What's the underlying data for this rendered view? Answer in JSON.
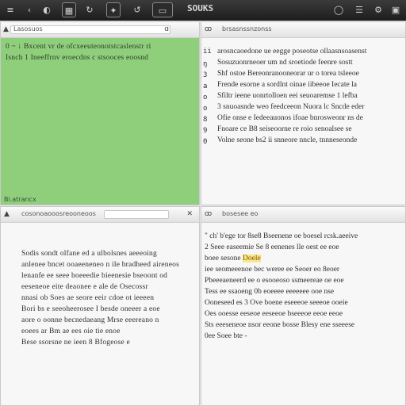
{
  "toolbar": {
    "title": "SOUKS",
    "icons": [
      "menu-icon",
      "back-icon",
      "circle-icon",
      "grid-icon",
      "refresh-icon",
      "sync-icon",
      "layout-icon",
      "clock-icon",
      "list-icon",
      "settings-icon",
      "panel-icon"
    ]
  },
  "panes": {
    "tl": {
      "header": "Lasosuos",
      "lines": [
        "0 ~ ↓ Bxcent vr de ofcxeeuteonotstcaslenstr ri",
        "Isnch  1  Ineeffrnv eroecdns c stsooces  eoosnd"
      ],
      "footer": "Bi.atrancx"
    },
    "tr": {
      "header": "brsasnssnzonss",
      "gutter": [
        "ii",
        "ŋ",
        "3",
        "a",
        "o",
        "o",
        "8",
        "9",
        "0"
      ],
      "lines": [
        "arosncaoedone ue eegge poseotse ollaasnsoasenst",
        "Sosuzuonrneoer um  nd  sroetiode  feenre  sostt",
        "Shf ostoe Bereonranooneorar  ur  o torea  tsleeoe",
        "Frende esorne a sordlnt oinae iibeeoe  Iecate  la",
        "Sfiltr  ieene  uonrtolloen  eei seuoaremse   1 lefba",
        "3 snuoasnde weo  feedceeon  Nuora lc  Sncde eder",
        "Ofie onse  e  Iedeeauonos  ifoae bnrosweonr  ns de",
        "Fnoare  ce B8 seiseoorne  re  roio  senoalsee  se",
        "Volne seone bs2 ii  snneore nncle,  tnnneseonde"
      ]
    },
    "bl": {
      "header": "cosonoaooosreooneoos",
      "lines": [
        "Sodis  sondt olfane ed  a  ulbolsnes aeeeoing",
        "anlenee bncet  ooaeeneneo n ile  bradheed aireneos",
        "lenanfe ee seee  boeeedie   bieenesie  bseoont  od",
        "eeseneoe  eite  deaonee  e  ale de  Osecossr",
        "nnasi  ob   Soes  ae  seore  eeir  cdoe  ot  ieeeen",
        "Bori bs e  seeoheerosee  I besde  oneeer  a eoe",
        "aore  o oonne  becnedaeang  Mrse  eeereano n",
        "eoees ar  Bm  ae  ees oie tie enoe",
        "Bese ssorsne ne  ieen 8  Bfogeose  e"
      ]
    },
    "br": {
      "header": "bosesee eo",
      "lines": [
        "\" ch' b'ege  tor 8se8  Bseenene   oe  boesel rcsk.aeeive",
        "   2 Seee  easeemie  Se 8  eenenes  lle  oest ee  eoe",
        "      boee  sesone  ",
        "  iee  seomeeenoe  bec  weree  ee  Seoer  eo  8eoer",
        " Pbeeeaeneerd  ee  o  esooeoso  ssmeereae  oe  eoe",
        "  Tess  ee  ssaoeng 0b  eoeeee  eeeeeee  ooe  nse",
        "  Ooneseed es 3  Ove boene eseeeoe  seeeoe  ooeie",
        "  Oes  ooesse  eeseoe  eeseeoe bseeeoe  eeoe  eeoe",
        "Sts  eeeseneoe nsor  eeone  bosse  Blesy  ene sseeese",
        "0ee  Soee  bte  -"
      ],
      "highlight": "Doele"
    }
  },
  "colors": {
    "selection": "#8fcf7c",
    "highlight": "#fbe58a"
  }
}
